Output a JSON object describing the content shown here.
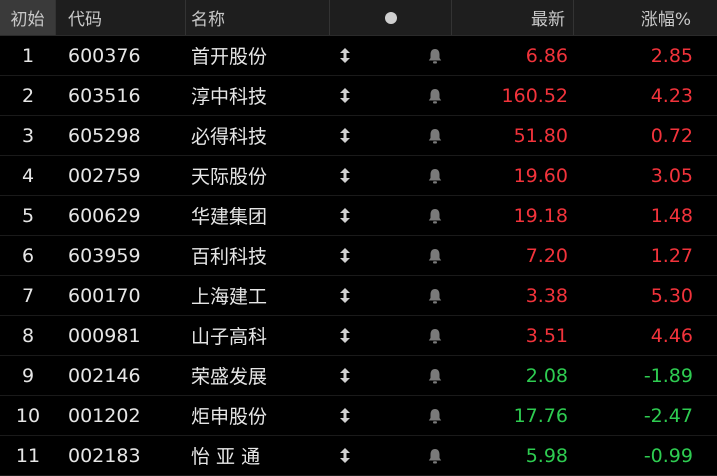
{
  "header": {
    "index": "初始",
    "code": "代码",
    "name": "名称",
    "price": "最新",
    "pct": "涨幅%"
  },
  "colors": {
    "up": "#f2333b",
    "down": "#2ecc51"
  },
  "rows": [
    {
      "index": "1",
      "code": "600376",
      "name": "首开股份",
      "price": "6.86",
      "pct": "2.85",
      "dir": "up"
    },
    {
      "index": "2",
      "code": "603516",
      "name": "淳中科技",
      "price": "160.52",
      "pct": "4.23",
      "dir": "up"
    },
    {
      "index": "3",
      "code": "605298",
      "name": "必得科技",
      "price": "51.80",
      "pct": "0.72",
      "dir": "up"
    },
    {
      "index": "4",
      "code": "002759",
      "name": "天际股份",
      "price": "19.60",
      "pct": "3.05",
      "dir": "up"
    },
    {
      "index": "5",
      "code": "600629",
      "name": "华建集团",
      "price": "19.18",
      "pct": "1.48",
      "dir": "up"
    },
    {
      "index": "6",
      "code": "603959",
      "name": "百利科技",
      "price": "7.20",
      "pct": "1.27",
      "dir": "up"
    },
    {
      "index": "7",
      "code": "600170",
      "name": "上海建工",
      "price": "3.38",
      "pct": "5.30",
      "dir": "up"
    },
    {
      "index": "8",
      "code": "000981",
      "name": "山子高科",
      "price": "3.51",
      "pct": "4.46",
      "dir": "up"
    },
    {
      "index": "9",
      "code": "002146",
      "name": "荣盛发展",
      "price": "2.08",
      "pct": "-1.89",
      "dir": "down"
    },
    {
      "index": "10",
      "code": "001202",
      "name": "炬申股份",
      "price": "17.76",
      "pct": "-2.47",
      "dir": "down"
    },
    {
      "index": "11",
      "code": "002183",
      "name": "怡 亚 通",
      "price": "5.98",
      "pct": "-0.99",
      "dir": "down"
    }
  ]
}
